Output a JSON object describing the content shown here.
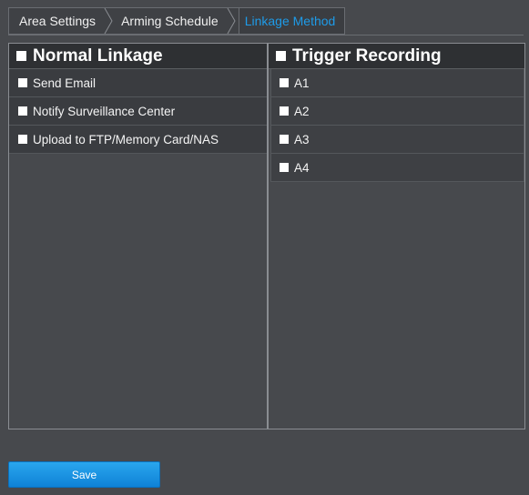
{
  "tabs": {
    "area_settings": "Area Settings",
    "arming_schedule": "Arming Schedule",
    "linkage_method": "Linkage Method"
  },
  "normal_linkage": {
    "title": "Normal Linkage",
    "items": [
      "Send Email",
      "Notify Surveillance Center",
      "Upload to FTP/Memory Card/NAS"
    ]
  },
  "trigger_recording": {
    "title": "Trigger Recording",
    "items": [
      "A1",
      "A2",
      "A3",
      "A4"
    ]
  },
  "save_label": "Save",
  "colors": {
    "accent": "#1e9be8",
    "background": "#47494d",
    "header": "#2e3033"
  }
}
